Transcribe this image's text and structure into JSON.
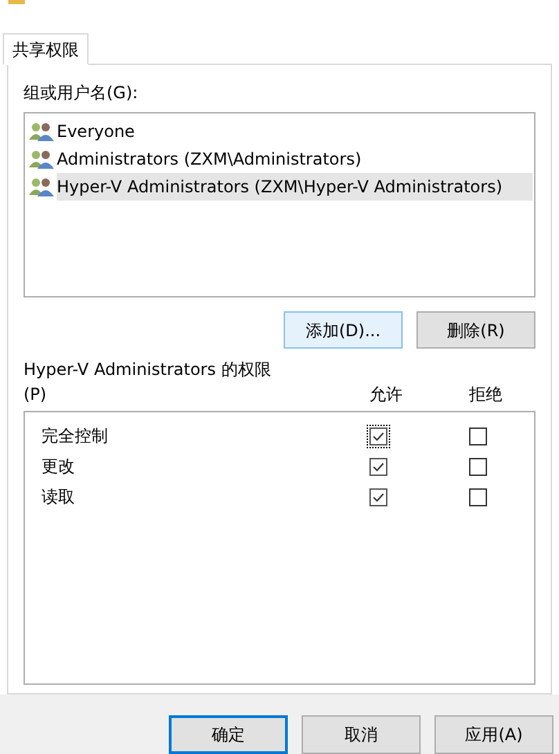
{
  "tabs": [
    {
      "label": "共享权限",
      "selected": true
    }
  ],
  "groups": {
    "label": "组或用户名(G):",
    "items": [
      {
        "name": "Everyone",
        "selected": false
      },
      {
        "name": "Administrators (ZXM\\Administrators)",
        "selected": false
      },
      {
        "name": "Hyper-V Administrators (ZXM\\Hyper-V Administrators)",
        "selected": true
      }
    ]
  },
  "group_buttons": [
    {
      "label": "添加(D)...",
      "hover": true
    },
    {
      "label": "删除(R)",
      "hover": false
    }
  ],
  "permissions": {
    "label": "Hyper-V Administrators 的权限",
    "label_suffix": "(P)",
    "columns": [
      "允许",
      "拒绝"
    ],
    "rows": [
      {
        "name": "完全控制",
        "allow": true,
        "deny": false,
        "focused": true
      },
      {
        "name": "更改",
        "allow": true,
        "deny": false,
        "focused": false
      },
      {
        "name": "读取",
        "allow": true,
        "deny": false,
        "focused": false
      }
    ]
  },
  "buttons": [
    {
      "label": "确定",
      "default": true
    },
    {
      "label": "取消",
      "default": false
    },
    {
      "label": "应用(A)",
      "default": false
    }
  ]
}
